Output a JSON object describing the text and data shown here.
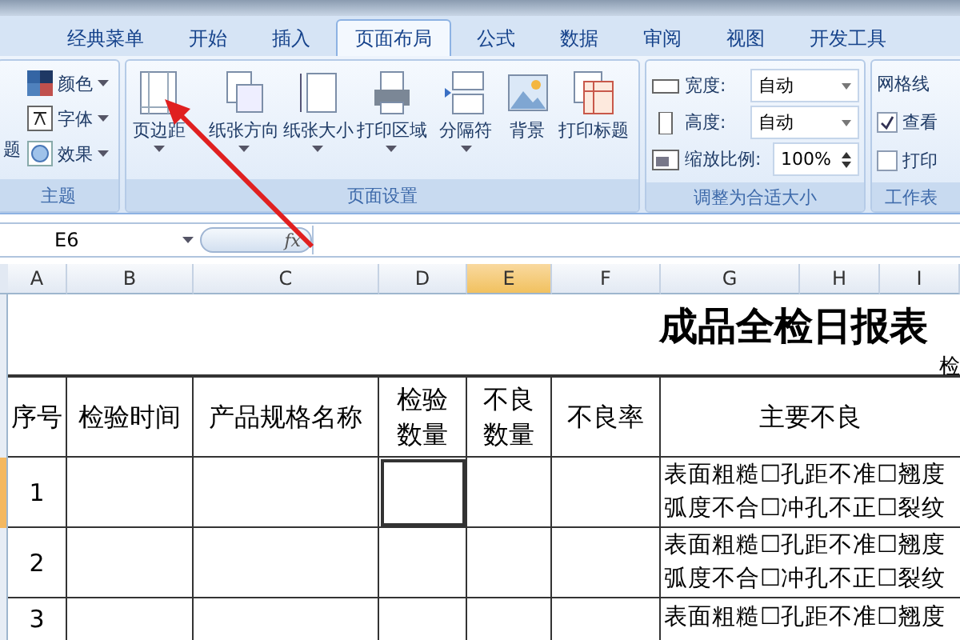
{
  "ribbon": {
    "tabs": [
      {
        "label": "经典菜单",
        "selected": false
      },
      {
        "label": "开始",
        "selected": false
      },
      {
        "label": "插入",
        "selected": false
      },
      {
        "label": "页面布局",
        "selected": true
      },
      {
        "label": "公式",
        "selected": false
      },
      {
        "label": "数据",
        "selected": false
      },
      {
        "label": "审阅",
        "selected": false
      },
      {
        "label": "视图",
        "selected": false
      },
      {
        "label": "开发工具",
        "selected": false
      }
    ],
    "theme_group": {
      "label": "主题",
      "button_fragment": "题",
      "items": [
        {
          "label": "颜色"
        },
        {
          "label": "字体"
        },
        {
          "label": "效果"
        }
      ]
    },
    "page_setup_group": {
      "label": "页面设置",
      "buttons": [
        {
          "label": "页边距",
          "dropdown": true
        },
        {
          "label": "纸张方向",
          "dropdown": true
        },
        {
          "label": "纸张大小",
          "dropdown": true
        },
        {
          "label": "打印区域",
          "dropdown": true
        },
        {
          "label": "分隔符",
          "dropdown": true
        },
        {
          "label": "背景",
          "dropdown": false
        },
        {
          "label": "打印标题",
          "dropdown": false
        }
      ]
    },
    "scale_group": {
      "label": "调整为合适大小",
      "fields": [
        {
          "label": "宽度:",
          "value": "自动",
          "kind": "dropdown"
        },
        {
          "label": "高度:",
          "value": "自动",
          "kind": "dropdown"
        },
        {
          "label": "缩放比例:",
          "value": "100%",
          "kind": "spinner"
        }
      ]
    },
    "sheet_options_group": {
      "label": "工作表",
      "heading": "网格线",
      "options": [
        {
          "label": "查看",
          "checked": true
        },
        {
          "label": "打印",
          "checked": false
        }
      ]
    }
  },
  "formula_bar": {
    "name_box": "E6",
    "function_label": "fx"
  },
  "sheet": {
    "columns": [
      {
        "label": "A",
        "selected": false
      },
      {
        "label": "B",
        "selected": false
      },
      {
        "label": "C",
        "selected": false
      },
      {
        "label": "D",
        "selected": false
      },
      {
        "label": "E",
        "selected": true
      },
      {
        "label": "F",
        "selected": false
      },
      {
        "label": "G",
        "selected": false
      },
      {
        "label": "H",
        "selected": false
      },
      {
        "label": "I",
        "selected": false
      }
    ],
    "title": "成品全检日报表",
    "title_fragment": "检",
    "headers": [
      "序号",
      "检验时间",
      "产品规格名称",
      "检验数量",
      "不良数量",
      "不良率",
      "主要不良"
    ],
    "rows": [
      {
        "number": "1",
        "selected": true,
        "defects": [
          "表面粗糙☐孔距不准☐翘度",
          "弧度不合☐冲孔不正☐裂纹"
        ]
      },
      {
        "number": "2",
        "selected": false,
        "defects": [
          "表面粗糙☐孔距不准☐翘度",
          "弧度不合☐冲孔不正☐裂纹"
        ]
      },
      {
        "number": "3",
        "selected": false,
        "defects": [
          "表面粗糙☐孔距不准☐翘度"
        ]
      }
    ]
  }
}
